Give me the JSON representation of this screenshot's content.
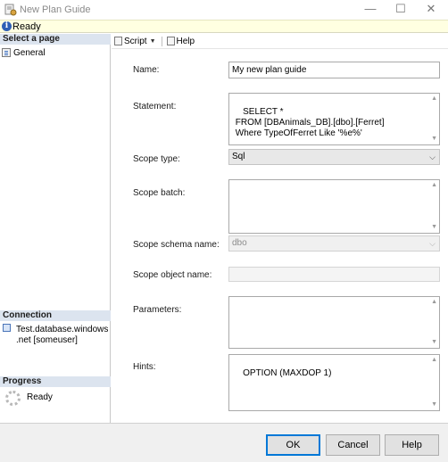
{
  "window": {
    "title": "New Plan Guide",
    "minimize_glyph": "—",
    "maximize_glyph": "☐",
    "close_glyph": "✕"
  },
  "status": {
    "text": "Ready",
    "icon": "info-icon"
  },
  "left": {
    "select_page_header": "Select a page",
    "pages": [
      {
        "label": "General",
        "icon": "page-icon"
      }
    ],
    "connection_header": "Connection",
    "connection_text": "Test.database.windows\n.net [someuser]",
    "progress_header": "Progress",
    "progress_text": "Ready"
  },
  "toolbar": {
    "script_label": "Script",
    "help_label": "Help"
  },
  "form": {
    "name_label": "Name:",
    "name_value": "My new plan guide",
    "statement_label": "Statement:",
    "statement_value": "SELECT *\n FROM [DBAnimals_DB].[dbo].[Ferret]\n Where TypeOfFerret Like '%e%'",
    "scope_type_label": "Scope type:",
    "scope_type_value": "Sql",
    "scope_batch_label": "Scope batch:",
    "scope_batch_value": "",
    "scope_schema_label": "Scope schema name:",
    "scope_schema_value": "dbo",
    "scope_object_label": "Scope object name:",
    "scope_object_value": "",
    "parameters_label": "Parameters:",
    "parameters_value": "",
    "hints_label": "Hints:",
    "hints_value": "OPTION (MAXDOP 1)"
  },
  "buttons": {
    "ok": "OK",
    "cancel": "Cancel",
    "help": "Help"
  },
  "colors": {
    "accent": "#0078d7",
    "status_bg": "#ffffe1",
    "section_header_bg": "#dce4ef"
  }
}
